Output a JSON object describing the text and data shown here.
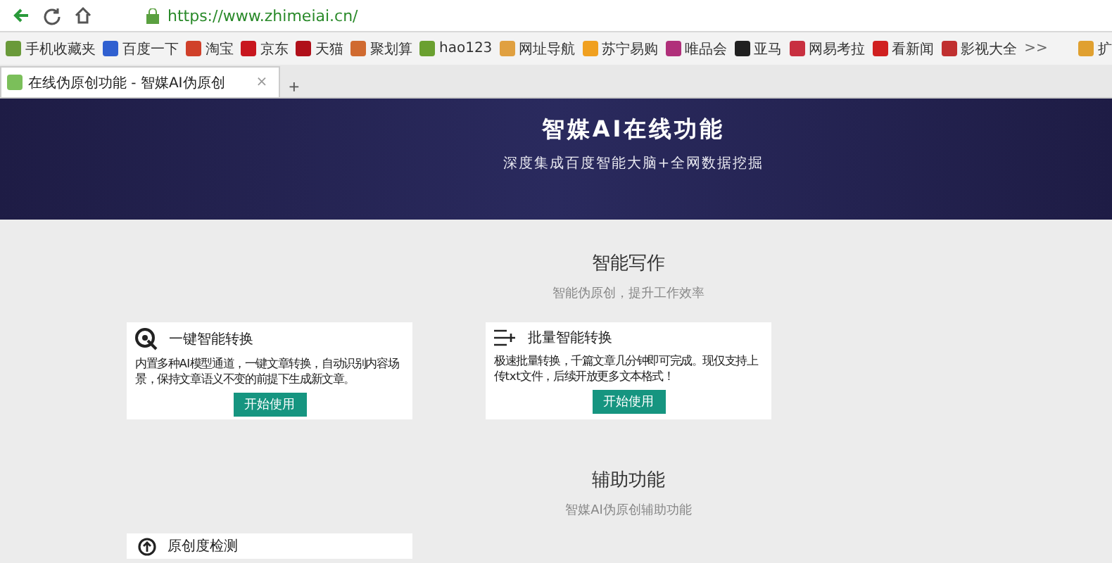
{
  "browser": {
    "url": "https://www.zhimeiai.cn/",
    "bookmarks": [
      {
        "label": "手机收藏夹",
        "color": "#6a9a3a"
      },
      {
        "label": "百度一下",
        "color": "#3060d0"
      },
      {
        "label": "淘宝",
        "color": "#d0402a"
      },
      {
        "label": "京东",
        "color": "#c8161e"
      },
      {
        "label": "天猫",
        "color": "#b0101a"
      },
      {
        "label": "聚划算",
        "color": "#d06a30"
      },
      {
        "label": "hao123",
        "color": "#6aa030"
      },
      {
        "label": "网址导航",
        "color": "#e0a040"
      },
      {
        "label": "苏宁易购",
        "color": "#f0a020"
      },
      {
        "label": "唯品会",
        "color": "#b0307a"
      },
      {
        "label": "亚马",
        "color": "#202020"
      },
      {
        "label": "网易考拉",
        "color": "#c83040"
      },
      {
        "label": "看新闻",
        "color": "#d02020"
      },
      {
        "label": "影视大全",
        "color": "#c03030"
      }
    ],
    "more": ">>",
    "extensions": "扩",
    "tabs": [
      {
        "title": "在线伪原创功能 - 智媒AI伪原创",
        "selected": true
      }
    ],
    "tab_close": "×",
    "new_tab": "+"
  },
  "hero": {
    "title": "智媒AI在线功能",
    "subtitle": "深度集成百度智能大脑+全网数据挖掘"
  },
  "sections": [
    {
      "title": "智能写作",
      "subtitle": "智能伪原创，提升工作效率",
      "cards": [
        {
          "kind": "target",
          "title": "一键智能转换",
          "text": "内置多种AI模型通道，一键文章转换，自动识别内容场景，保持文章语义不变的前提下生成新文章。",
          "button": "开始使用"
        },
        {
          "kind": "list",
          "title": "批量智能转换",
          "text": "极速批量转换，千篇文章几分钟即可完成。现仅支持上传txt文件，后续开放更多文本格式！",
          "button": "开始使用"
        }
      ]
    },
    {
      "title": "辅助功能",
      "subtitle": "智媒AI伪原创辅助功能",
      "cards": [
        {
          "kind": "upload",
          "title": "原创度检测"
        }
      ]
    }
  ]
}
